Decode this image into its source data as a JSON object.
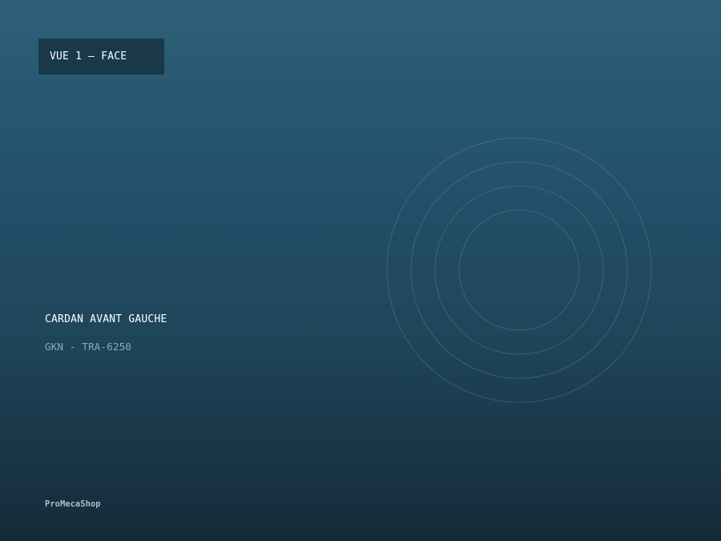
{
  "view": {
    "label": "VUE 1 — FACE"
  },
  "product": {
    "name": "CARDAN AVANT GAUCHE",
    "reference": "GKN - TRA-6250"
  },
  "brand": {
    "name": "ProMecaShop"
  },
  "decoration": {
    "icon": "concentric-rings-icon",
    "ring_color": "#6f93a6"
  },
  "colors": {
    "background_top": "#2d6078",
    "background_bottom": "#152a38",
    "badge_background": "#19394b",
    "title_text": "#ffffff",
    "reference_text": "#8fa9b6",
    "brand_text": "#a9bec9"
  }
}
